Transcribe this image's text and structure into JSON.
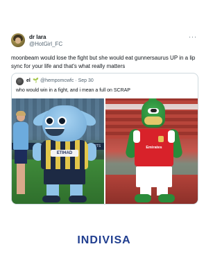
{
  "tweet": {
    "author": {
      "display_name": "dr lara",
      "handle": "@HotGirl_FC"
    },
    "text": "moonbeam would lose the fight but she would eat gunnersaurus UP in a lip sync for your life and that's what really matters",
    "more_icon": "more-dots-icon"
  },
  "quote": {
    "author": {
      "display_name": "el",
      "emoji": "🌱",
      "handle": "@hempomcwfc",
      "date": "Sep 30"
    },
    "text": "who would win in a fight, and i mean a full on SCRAP",
    "photos": [
      {
        "sponsor_text": "ETIHAD",
        "board_text": "EA SPORTS"
      },
      {
        "sponsor_text": "Emirates"
      }
    ]
  },
  "brand": {
    "wordmark": "INDIVISA",
    "color": "#1f3d8f"
  },
  "colors": {
    "text": "#0f1419",
    "muted": "#536471",
    "border": "#cfd9de"
  }
}
